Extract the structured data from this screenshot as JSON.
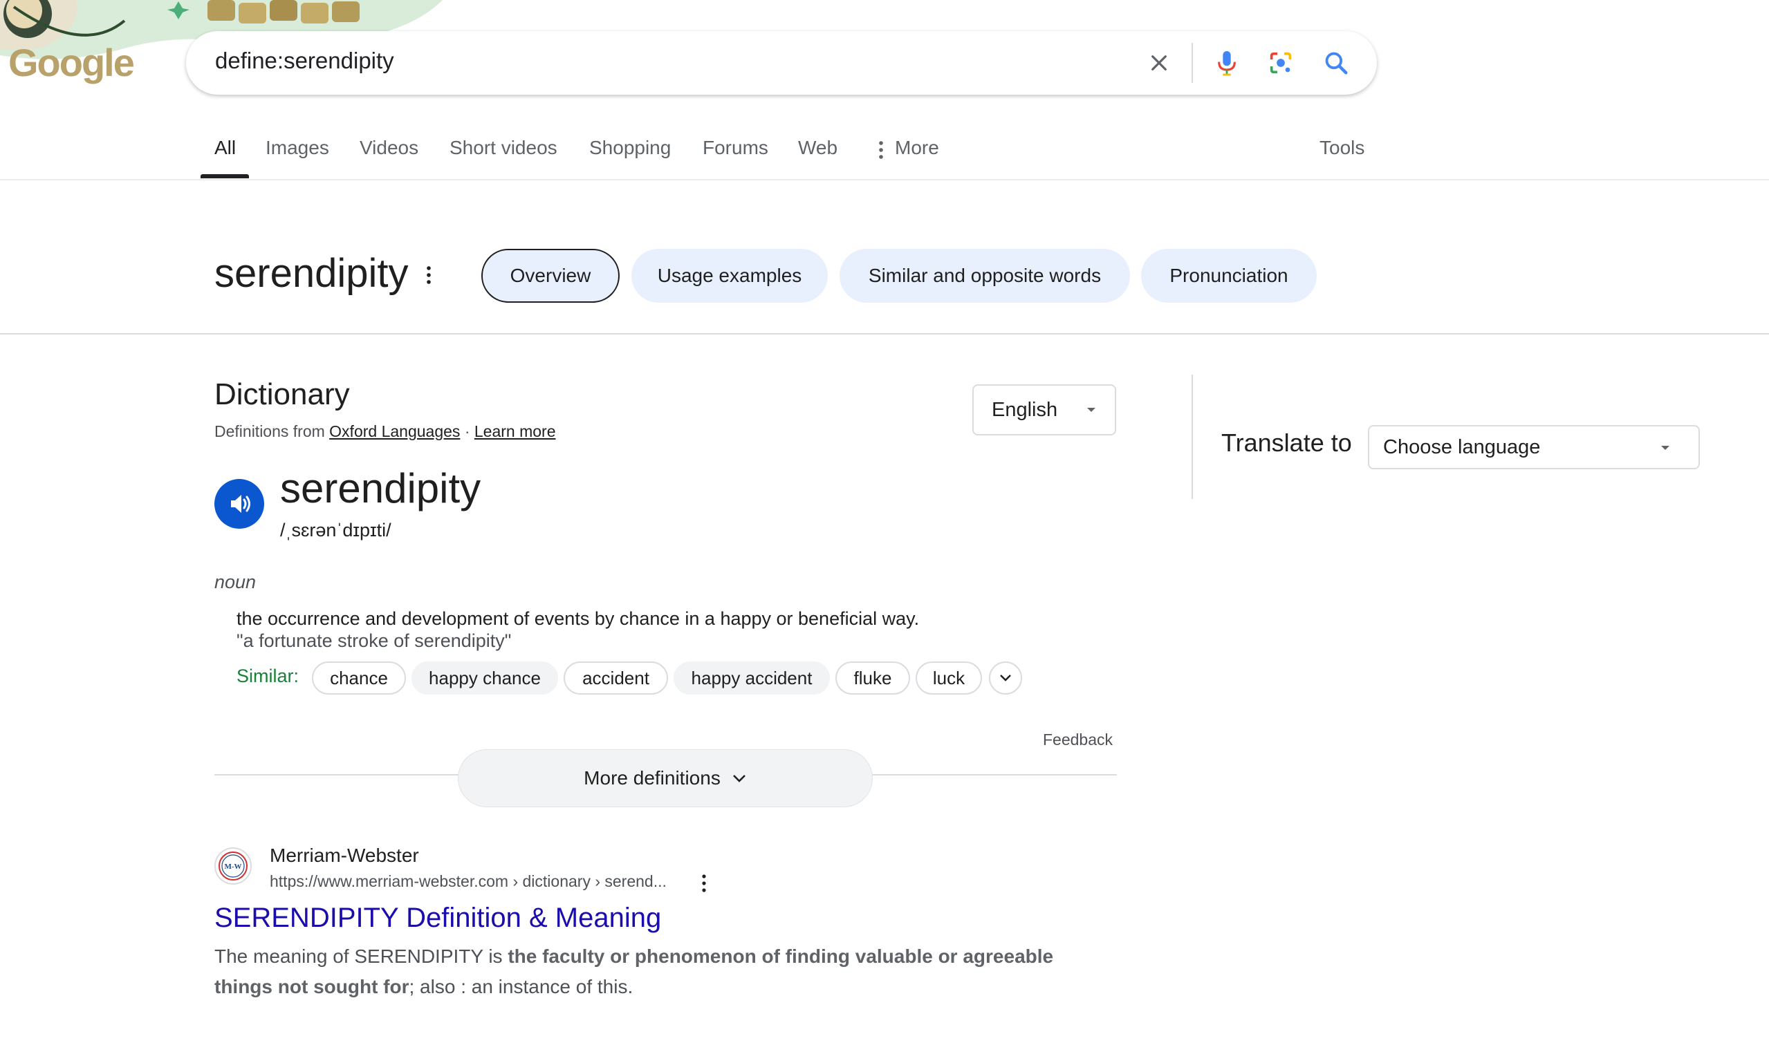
{
  "logo": {
    "text": "Google"
  },
  "search": {
    "query": "define:serendipity"
  },
  "tabs": [
    {
      "label": "All",
      "active": true
    },
    {
      "label": "Images"
    },
    {
      "label": "Videos"
    },
    {
      "label": "Short videos"
    },
    {
      "label": "Shopping"
    },
    {
      "label": "Forums"
    },
    {
      "label": "Web"
    },
    {
      "label": "More"
    }
  ],
  "tools_label": "Tools",
  "word_header": {
    "title": "serendipity",
    "chips": [
      {
        "label": "Overview",
        "selected": true
      },
      {
        "label": "Usage examples"
      },
      {
        "label": "Similar and opposite words"
      },
      {
        "label": "Pronunciation"
      }
    ]
  },
  "dictionary": {
    "title": "Dictionary",
    "source_prefix": "Definitions from",
    "source_link": "Oxford Languages",
    "separator": "·",
    "learn_more": "Learn more",
    "language": "English",
    "headword": "serendipity",
    "phonetic": "/ˌsɛrənˈdɪpɪti/",
    "part_of_speech": "noun",
    "definition": "the occurrence and development of events by chance in a happy or beneficial way.",
    "example": "\"a fortunate stroke of serendipity\"",
    "similar_label": "Similar:",
    "similar": [
      "chance",
      "happy chance",
      "accident",
      "happy accident",
      "fluke",
      "luck"
    ],
    "feedback": "Feedback",
    "more_definitions": "More definitions"
  },
  "translate": {
    "label": "Translate to",
    "placeholder": "Choose language"
  },
  "result": {
    "favicon_text": "M-W",
    "site_name": "Merriam-Webster",
    "url": "https://www.merriam-webster.com › dictionary › serend...",
    "title": "SERENDIPITY Definition & Meaning",
    "snippet_pre": "The meaning of SERENDIPITY is ",
    "snippet_bold": "the faculty or phenomenon of finding valuable or agreeable things not sought for",
    "snippet_post": "; also : an instance of this."
  },
  "colors": {
    "accent": "#0b57d0",
    "link": "#1a0dab",
    "similar": "#188038",
    "chip_bg": "#e8f0fe"
  }
}
